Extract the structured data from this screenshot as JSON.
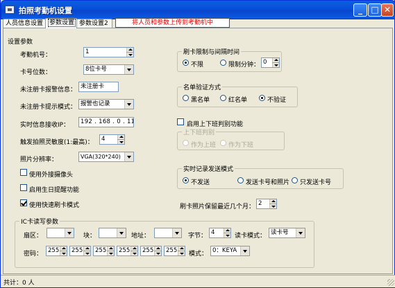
{
  "window": {
    "title": "拍照考勤机设置",
    "close_label": "✕",
    "max_label": "□",
    "min_label": "_"
  },
  "tabs": [
    {
      "label": "人员信息设置"
    },
    {
      "label": "参数设置"
    },
    {
      "label": "参数设置2"
    }
  ],
  "notice": "将人员和参数上传到考勤机中",
  "settings": {
    "section_title": "设置参数",
    "machine_no": {
      "label": "考勤机号：",
      "value": "1"
    },
    "card_digits": {
      "label": "卡号位数：",
      "value": "8位卡号"
    },
    "unreg_alarm_info": {
      "label": "未注册卡报警信息：",
      "value": "未注册卡"
    },
    "unreg_alarm_mode": {
      "label": "未注册卡提示模式：",
      "value": "报警也记录"
    },
    "realtime_ip": {
      "label": "实时信息接收IP：",
      "value": "192 . 168 . 0 . 110"
    },
    "sensitivity": {
      "label": "触发拍照灵敏度(1:最高)：",
      "value": "4"
    },
    "resolution": {
      "label": "照片分辨率：",
      "value": "VGA(320*240)"
    },
    "ext_camera": {
      "label": "使用外接摄像头",
      "checked": false
    },
    "birthday": {
      "label": "启用生日提醒功能",
      "checked": false
    },
    "fast_card": {
      "label": "使用快速刷卡模式",
      "checked": true
    }
  },
  "swipe_limit": {
    "title": "刷卡限制与间隔时间",
    "unlimited": "不限",
    "limit_minutes": "限制分钟：",
    "minutes_value": "0"
  },
  "list_verify": {
    "title": "名单验证方式",
    "options": [
      "黑名单",
      "红名单",
      "不验证"
    ],
    "selected": 2
  },
  "onoff": {
    "enable_label": "启用上下班判别功能",
    "enabled": false,
    "group_title": "上下班判别",
    "options": [
      "作为上班",
      "作为下班"
    ]
  },
  "realtime_send": {
    "title": "实时记录发送模式",
    "options": [
      "不发送",
      "发送卡号和照片",
      "只发送卡号"
    ],
    "selected": 0
  },
  "photo_months": {
    "label": "刷卡照片保留最近几个月：",
    "value": "2"
  },
  "ic": {
    "title": "IC卡读写参数",
    "sector_label": "扇区：",
    "sector_value": "",
    "block_label": "块：",
    "block_value": "",
    "address_label": "地址：",
    "address_value": "",
    "bytes_label": "字节：",
    "bytes_value": "4",
    "read_mode_label": "读卡模式：",
    "read_mode_value": "读卡号",
    "password_label": "密码：",
    "password": [
      "255",
      "255",
      "255",
      "255",
      "255",
      "255"
    ],
    "mode_label": "模式：",
    "mode_value": "0：KEYA"
  },
  "status": "共计：0 人"
}
